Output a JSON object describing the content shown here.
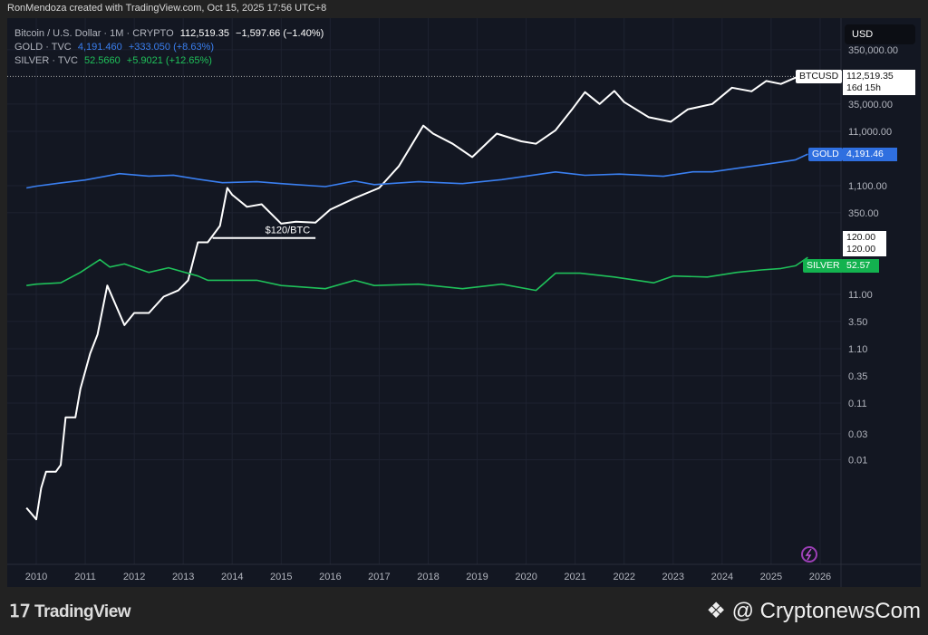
{
  "header": {
    "credit": "RonMendoza created with TradingView.com, Oct 15, 2025 17:56 UTC+8"
  },
  "legend": [
    {
      "name": "Bitcoin / U.S. Dollar · 1M · CRYPTO",
      "value": "112,519.35",
      "change": "−1,597.66 (−1.40%)",
      "color": "#ffffff"
    },
    {
      "name": "GOLD · TVC",
      "value": "4,191.460",
      "change": "+333.050 (+8.63%)",
      "color": "#3a7ff0"
    },
    {
      "name": "SILVER · TVC",
      "value": "52.5660",
      "change": "+5.9021 (+12.65%)",
      "color": "#1fc15a"
    }
  ],
  "currency": "USD",
  "tags": {
    "btc_label": "BTCUSD",
    "btc_price": "112,519.35",
    "btc_countdown": "16d 15h",
    "gold_label": "GOLD",
    "gold_price": "4,191.46",
    "silver_label": "SILVER",
    "silver_price": "52.57",
    "line_price_1": "120.00",
    "line_price_2": "120.00"
  },
  "annotation": {
    "text": "$120/BTC",
    "value": 120,
    "x_from": 2013.6,
    "x_to": 2015.7
  },
  "footer": {
    "tradingview": "TradingView",
    "cryptonews": "@ CryptonewsCom"
  },
  "chart_data": {
    "type": "line",
    "yscale": "log",
    "ylim": [
      0.0003,
      500000
    ],
    "xlim": [
      2009.4,
      2026.4
    ],
    "y_ticks": [
      "350,000.00",
      "35,000.00",
      "11,000.00",
      "1,100.00",
      "350.00",
      "11.00",
      "3.50",
      "1.10",
      "0.35",
      "0.11",
      "0.03",
      "0.01"
    ],
    "y_tick_values": [
      350000,
      35000,
      11000,
      1100,
      350,
      11,
      3.5,
      1.1,
      0.35,
      0.11,
      0.03,
      0.01
    ],
    "x_ticks": [
      "2010",
      "2011",
      "2012",
      "2013",
      "2014",
      "2015",
      "2016",
      "2017",
      "2018",
      "2019",
      "2020",
      "2021",
      "2022",
      "2023",
      "2024",
      "2025",
      "2026"
    ],
    "series": [
      {
        "name": "BTCUSD",
        "color": "#ffffff",
        "points": [
          [
            2009.8,
            0.0013
          ],
          [
            2010.0,
            0.0008
          ],
          [
            2010.1,
            0.003
          ],
          [
            2010.2,
            0.006
          ],
          [
            2010.4,
            0.006
          ],
          [
            2010.5,
            0.008
          ],
          [
            2010.6,
            0.06
          ],
          [
            2010.8,
            0.06
          ],
          [
            2010.9,
            0.2
          ],
          [
            2011.1,
            0.9
          ],
          [
            2011.25,
            2
          ],
          [
            2011.45,
            16
          ],
          [
            2011.8,
            3
          ],
          [
            2012.0,
            5
          ],
          [
            2012.3,
            5
          ],
          [
            2012.6,
            10
          ],
          [
            2012.9,
            13
          ],
          [
            2013.1,
            20
          ],
          [
            2013.3,
            100
          ],
          [
            2013.5,
            100
          ],
          [
            2013.75,
            200
          ],
          [
            2013.9,
            1000
          ],
          [
            2014.0,
            750
          ],
          [
            2014.3,
            450
          ],
          [
            2014.6,
            500
          ],
          [
            2015.0,
            220
          ],
          [
            2015.3,
            240
          ],
          [
            2015.7,
            230
          ],
          [
            2016.0,
            400
          ],
          [
            2016.5,
            650
          ],
          [
            2017.0,
            1000
          ],
          [
            2017.4,
            2500
          ],
          [
            2017.9,
            14000
          ],
          [
            2018.1,
            10000
          ],
          [
            2018.5,
            6500
          ],
          [
            2018.9,
            3700
          ],
          [
            2019.4,
            10000
          ],
          [
            2019.9,
            7200
          ],
          [
            2020.2,
            6500
          ],
          [
            2020.6,
            11500
          ],
          [
            2020.95,
            29000
          ],
          [
            2021.2,
            58000
          ],
          [
            2021.5,
            35000
          ],
          [
            2021.8,
            61000
          ],
          [
            2022.0,
            38000
          ],
          [
            2022.5,
            20000
          ],
          [
            2022.95,
            16500
          ],
          [
            2023.3,
            28000
          ],
          [
            2023.8,
            35000
          ],
          [
            2024.2,
            70000
          ],
          [
            2024.6,
            60000
          ],
          [
            2024.9,
            93000
          ],
          [
            2025.2,
            82000
          ],
          [
            2025.5,
            107000
          ],
          [
            2025.75,
            112519
          ]
        ]
      },
      {
        "name": "GOLD",
        "color": "#3a7ff0",
        "points": [
          [
            2009.8,
            1000
          ],
          [
            2010.0,
            1080
          ],
          [
            2010.5,
            1240
          ],
          [
            2011.0,
            1400
          ],
          [
            2011.7,
            1830
          ],
          [
            2012.3,
            1650
          ],
          [
            2012.8,
            1720
          ],
          [
            2013.3,
            1450
          ],
          [
            2013.8,
            1250
          ],
          [
            2014.5,
            1300
          ],
          [
            2015.0,
            1200
          ],
          [
            2015.9,
            1060
          ],
          [
            2016.5,
            1340
          ],
          [
            2016.9,
            1150
          ],
          [
            2017.8,
            1300
          ],
          [
            2018.7,
            1200
          ],
          [
            2019.5,
            1420
          ],
          [
            2020.6,
            1970
          ],
          [
            2021.2,
            1710
          ],
          [
            2021.9,
            1800
          ],
          [
            2022.8,
            1640
          ],
          [
            2023.4,
            1980
          ],
          [
            2023.8,
            1980
          ],
          [
            2024.3,
            2300
          ],
          [
            2024.8,
            2650
          ],
          [
            2025.2,
            3000
          ],
          [
            2025.5,
            3300
          ],
          [
            2025.75,
            4191
          ]
        ]
      },
      {
        "name": "SILVER",
        "color": "#1fc15a",
        "points": [
          [
            2009.8,
            16
          ],
          [
            2010.0,
            17
          ],
          [
            2010.5,
            18
          ],
          [
            2010.9,
            28
          ],
          [
            2011.3,
            48
          ],
          [
            2011.5,
            35
          ],
          [
            2011.8,
            40
          ],
          [
            2012.3,
            28
          ],
          [
            2012.7,
            34
          ],
          [
            2013.3,
            24
          ],
          [
            2013.5,
            20
          ],
          [
            2014.0,
            20
          ],
          [
            2014.5,
            20
          ],
          [
            2015.0,
            16
          ],
          [
            2015.9,
            14
          ],
          [
            2016.5,
            20
          ],
          [
            2016.9,
            16
          ],
          [
            2017.8,
            17
          ],
          [
            2018.7,
            14
          ],
          [
            2019.5,
            17
          ],
          [
            2020.2,
            13
          ],
          [
            2020.6,
            27
          ],
          [
            2021.1,
            27
          ],
          [
            2021.8,
            23
          ],
          [
            2022.6,
            18
          ],
          [
            2023.0,
            24
          ],
          [
            2023.7,
            23
          ],
          [
            2024.3,
            28
          ],
          [
            2024.8,
            31
          ],
          [
            2025.2,
            33
          ],
          [
            2025.5,
            37
          ],
          [
            2025.75,
            52.57
          ]
        ]
      }
    ]
  }
}
